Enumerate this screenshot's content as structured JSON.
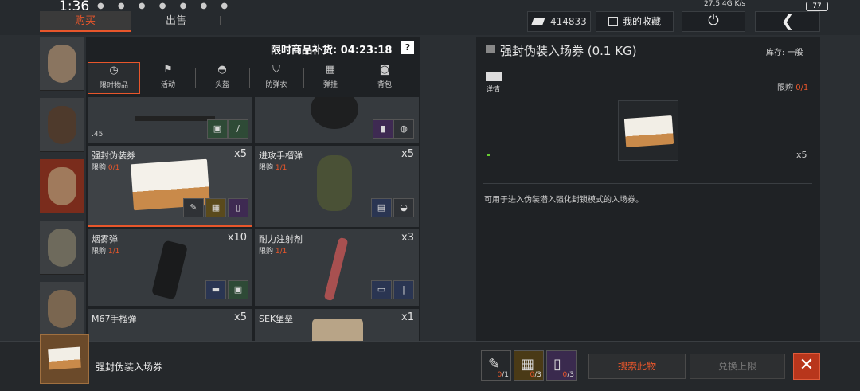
{
  "status_bar": {
    "time": "1:36",
    "right_text": "27.5 4G K/s",
    "battery": "77"
  },
  "tabs": [
    {
      "label": "购买"
    },
    {
      "label": "出售"
    }
  ],
  "header": {
    "currency": "414833",
    "favorites_label": "我的收藏",
    "power_glyph": "⏻",
    "back_glyph": "❮"
  },
  "restock": {
    "label": "限时商品补货: 04:23:18",
    "help": "?"
  },
  "categories": [
    {
      "label": "限时物品",
      "glyph": "◷"
    },
    {
      "label": "活动",
      "glyph": "⚑"
    },
    {
      "label": "头盔",
      "glyph": "◓"
    },
    {
      "label": "防弹衣",
      "glyph": "⛉"
    },
    {
      "label": "弹挂",
      "glyph": "▦"
    },
    {
      "label": "背包",
      "glyph": "◙"
    }
  ],
  "items": [
    {
      "name": "",
      "limit_prefix": "",
      "limit_count": "",
      "qty": "",
      "caliber": ".45"
    },
    {
      "name": "",
      "limit_prefix": "",
      "limit_count": "",
      "qty": ""
    },
    {
      "name": "强封伪装券",
      "limit_prefix": "限购",
      "limit_count": "0/1",
      "qty": "x5"
    },
    {
      "name": "进攻手榴弹",
      "limit_prefix": "限购",
      "limit_count": "1/1",
      "qty": "x5"
    },
    {
      "name": "烟雾弹",
      "limit_prefix": "限购",
      "limit_count": "1/1",
      "qty": "x10"
    },
    {
      "name": "耐力注射剂",
      "limit_prefix": "限购",
      "limit_count": "1/1",
      "qty": "x3"
    },
    {
      "name": "M67手榴弹",
      "limit_prefix": "",
      "limit_count": "",
      "qty": "x5"
    },
    {
      "name": "SEK堡垒",
      "limit_prefix": "",
      "limit_count": "",
      "qty": "x1"
    }
  ],
  "detail": {
    "title": "强封伪装入场券 (0.1 KG)",
    "stock": "库存: 一般",
    "detail_label": "详情",
    "limit_prefix": "限购",
    "limit_count": "0/1",
    "qty": "x5",
    "description": "可用于进入伪装潜入强化封锁模式的入场券。"
  },
  "bottom": {
    "name": "强封伪装入场券",
    "requirements": [
      {
        "have": "0",
        "need": "/1",
        "icon": "syringe-icon"
      },
      {
        "have": "0",
        "need": "/3",
        "icon": "crate-icon"
      },
      {
        "have": "0",
        "need": "/3",
        "icon": "bottle-icon"
      }
    ],
    "search_label": "搜索此物",
    "redeem_label": "兑换上限",
    "close_glyph": "✕"
  },
  "colors": {
    "accent": "#e8562b",
    "panel": "#1f2225",
    "card": "#363a3e"
  }
}
